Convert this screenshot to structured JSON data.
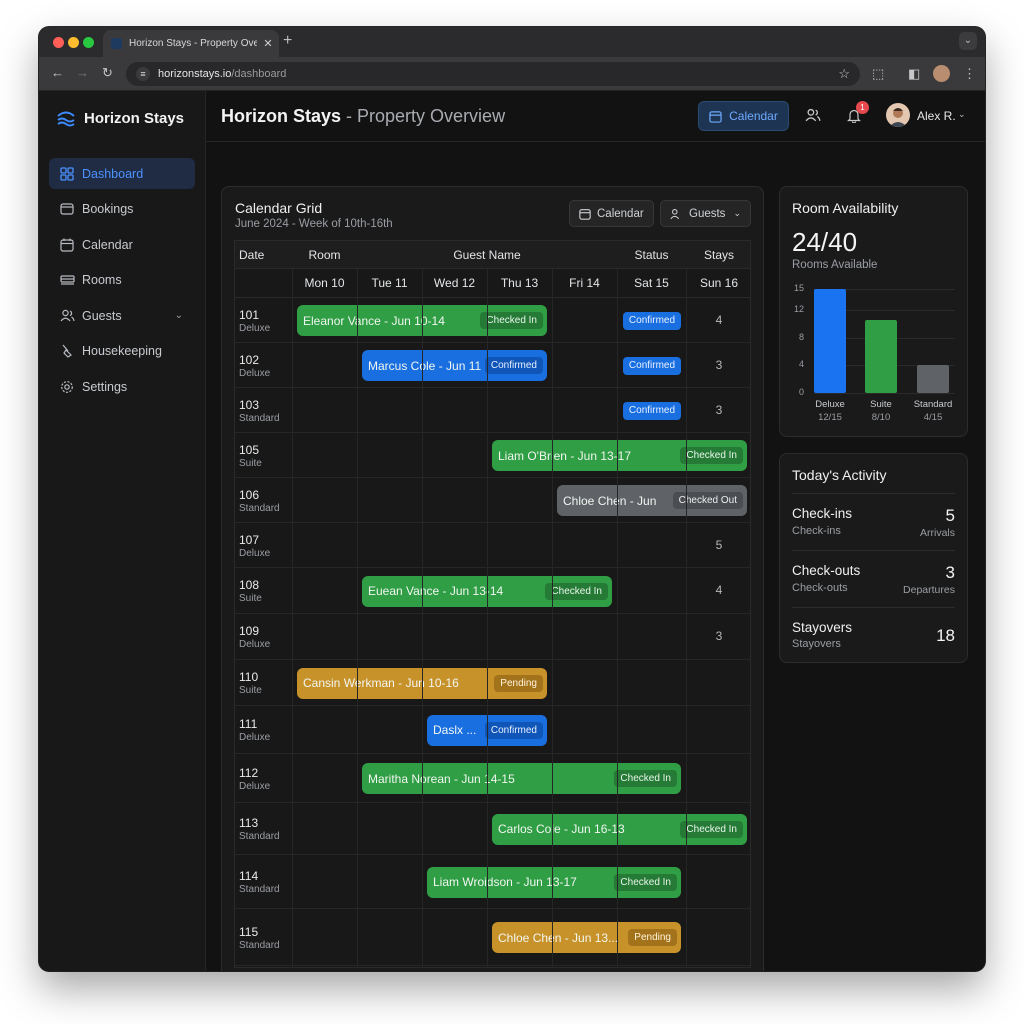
{
  "browser": {
    "tab_title": "Horizon Stays - Property Overview",
    "url_host": "horizonstays.io",
    "url_path": "/dashboard"
  },
  "sidebar": {
    "brand": "Horizon Stays",
    "items": [
      {
        "label": "Dashboard",
        "icon": "grid-icon",
        "active": true
      },
      {
        "label": "Bookings",
        "icon": "wallet-icon"
      },
      {
        "label": "Calendar",
        "icon": "calendar-icon"
      },
      {
        "label": "Rooms",
        "icon": "bed-icon"
      },
      {
        "label": "Guests",
        "icon": "users-icon",
        "expandable": true
      },
      {
        "label": "Housekeeping",
        "icon": "broom-icon"
      },
      {
        "label": "Settings",
        "icon": "gear-icon"
      }
    ]
  },
  "header": {
    "title_bold": "Horizon Stays",
    "title_rest": " - Property Overview",
    "calendar_button": "Calendar",
    "notification_count": "1",
    "user_name": "Alex R."
  },
  "calendar": {
    "title": "Calendar Grid",
    "subtitle": "June 2024 - Week of 10th-16th",
    "calendar_pill": "Calendar",
    "guests_pill": "Guests",
    "headers": {
      "date": "Date",
      "room": "Room",
      "guest_name": "Guest Name",
      "status": "Status",
      "stays": "Stays"
    },
    "days": [
      "Mon 10",
      "Tue 11",
      "Wed 12",
      "Thu 13",
      "Fri 14",
      "Sat 15",
      "Sun 16"
    ],
    "rows": [
      {
        "room": "101",
        "type": "Deluxe",
        "stays": "4"
      },
      {
        "room": "102",
        "type": "Deluxe",
        "stays": "3"
      },
      {
        "room": "103",
        "type": "Standard",
        "stays": "3"
      },
      {
        "room": "105",
        "type": "Suite",
        "stays": ""
      },
      {
        "room": "106",
        "type": "Standard",
        "stays": ""
      },
      {
        "room": "107",
        "type": "Deluxe",
        "stays": "5"
      },
      {
        "room": "108",
        "type": "Suite",
        "stays": "4"
      },
      {
        "room": "109",
        "type": "Deluxe",
        "stays": "3"
      },
      {
        "room": "110",
        "type": "Suite",
        "stays": ""
      },
      {
        "room": "111",
        "type": "Deluxe",
        "stays": ""
      },
      {
        "room": "112",
        "type": "Deluxe",
        "stays": ""
      },
      {
        "room": "113",
        "type": "Standard",
        "stays": ""
      },
      {
        "room": "114",
        "type": "Standard",
        "stays": ""
      },
      {
        "room": "115",
        "type": "Standard",
        "stays": ""
      }
    ],
    "bookings": [
      {
        "row": 0,
        "start_day": 0,
        "end_day": 3,
        "label": "Eleanor Vance - Jun 10-14",
        "status": "Checked In",
        "color": "green"
      },
      {
        "row": 1,
        "start_day": 1,
        "end_day": 3,
        "label": "Marcus Cole - Jun 11",
        "status": "Confirmed",
        "color": "blue"
      },
      {
        "row": 3,
        "start_day": 3,
        "end_day": 6,
        "label": "Liam O'Brien - Jun 13-17",
        "status": "Checked In",
        "color": "green"
      },
      {
        "row": 4,
        "start_day": 4,
        "end_day": 6,
        "label": "Chloe Chen - Jun",
        "status": "Checked Out",
        "color": "gray"
      },
      {
        "row": 6,
        "start_day": 1,
        "end_day": 4,
        "label": "Euean Vance - Jun 13-14",
        "status": "Checked In",
        "color": "green"
      },
      {
        "row": 8,
        "start_day": 0,
        "end_day": 3,
        "label": "Cansin Werkman - Jun 10-16",
        "status": "Pending",
        "color": "gold"
      },
      {
        "row": 9,
        "start_day": 2,
        "end_day": 3,
        "label": "Daslx ...",
        "status": "Confirmed",
        "color": "blue"
      },
      {
        "row": 10,
        "start_day": 1,
        "end_day": 5,
        "label": "Maritha Norean - Jun 14-15",
        "status": "Checked In",
        "color": "green"
      },
      {
        "row": 11,
        "start_day": 3,
        "end_day": 6,
        "label": "Carlos Cole - Jun 16-13",
        "status": "Checked In",
        "color": "green"
      },
      {
        "row": 12,
        "start_day": 2,
        "end_day": 5,
        "label": "Liam Wroidson - Jun 13-17",
        "status": "Checked In",
        "color": "green"
      },
      {
        "row": 13,
        "start_day": 3,
        "end_day": 5,
        "label": "Chloe Chen - Jun 13...",
        "status": "Pending",
        "color": "gold"
      }
    ],
    "status_badges": [
      {
        "row": 0,
        "label": "Confirmed"
      },
      {
        "row": 1,
        "label": "Confirmed"
      },
      {
        "row": 2,
        "label": "Confirmed"
      }
    ]
  },
  "availability": {
    "title": "Room Availability",
    "value": "24/40",
    "caption": "Rooms Available",
    "chart_data": {
      "type": "bar",
      "categories": [
        "Deluxe",
        "Suite",
        "Standard"
      ],
      "sublabels": [
        "12/15",
        "8/10",
        "4/15"
      ],
      "values": [
        15,
        10.5,
        4
      ],
      "colors": [
        "#1a73f0",
        "#2f9e44",
        "#5f6368"
      ],
      "yticks": [
        0,
        4,
        8,
        12,
        15
      ],
      "ylim": [
        0,
        16
      ]
    }
  },
  "activity": {
    "title": "Today's Activity",
    "items": [
      {
        "name": "Check-ins",
        "sub": "Check-ins",
        "value": "5",
        "value_sub": "Arrivals"
      },
      {
        "name": "Check-outs",
        "sub": "Check-outs",
        "value": "3",
        "value_sub": "Departures"
      },
      {
        "name": "Stayovers",
        "sub": "Stayovers",
        "value": "18",
        "value_sub": ""
      }
    ]
  },
  "colors": {
    "accent": "#1a6fe0",
    "checked_in": "#2f9e44",
    "pending": "#c8922a",
    "checked_out": "#5f6368"
  }
}
